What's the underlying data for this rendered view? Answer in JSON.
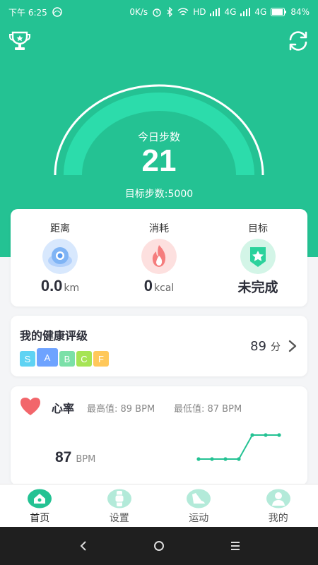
{
  "status_bar": {
    "time": "下午 6:25",
    "speed": "0K/s",
    "network_1": "HD",
    "network_2": "4G",
    "network_3": "4G",
    "battery": "84%"
  },
  "hero": {
    "today_label": "今日步数",
    "steps": "21",
    "goal_steps": "目标步数:5000"
  },
  "summary": {
    "distance": {
      "title": "距离",
      "value": "0.0",
      "unit": "km",
      "icon": "location-icon",
      "color": "#7fb4f5"
    },
    "calories": {
      "title": "消耗",
      "value": "0",
      "unit": "kcal",
      "icon": "flame-icon",
      "color": "#f57d7d"
    },
    "goal": {
      "title": "目标",
      "value": "未完成",
      "icon": "star-badge-icon",
      "color": "#2bd29c"
    }
  },
  "health": {
    "title": "我的健康评级",
    "grades": [
      {
        "label": "S",
        "color": "#5fd3f3",
        "active": false
      },
      {
        "label": "A",
        "color": "#6ea3ff",
        "active": true
      },
      {
        "label": "B",
        "color": "#7be0a8",
        "active": false
      },
      {
        "label": "C",
        "color": "#a6e455",
        "active": false
      },
      {
        "label": "F",
        "color": "#ffc85a",
        "active": false
      }
    ],
    "score": "89",
    "score_unit": "分"
  },
  "heart_rate": {
    "title": "心率",
    "max_label": "最高值: 89 BPM",
    "min_label": "最低值: 87 BPM",
    "value": "87",
    "unit": "BPM",
    "trend": [
      87,
      87,
      87,
      87,
      89,
      89,
      89
    ]
  },
  "bottom_nav": {
    "items": [
      {
        "label": "首页",
        "icon": "home-icon",
        "active": true
      },
      {
        "label": "设置",
        "icon": "watch-icon",
        "active": false
      },
      {
        "label": "运动",
        "icon": "shoe-icon",
        "active": false
      },
      {
        "label": "我的",
        "icon": "user-icon",
        "active": false
      }
    ]
  },
  "colors": {
    "accent": "#24c293",
    "text_dark": "#2d2f3a"
  }
}
